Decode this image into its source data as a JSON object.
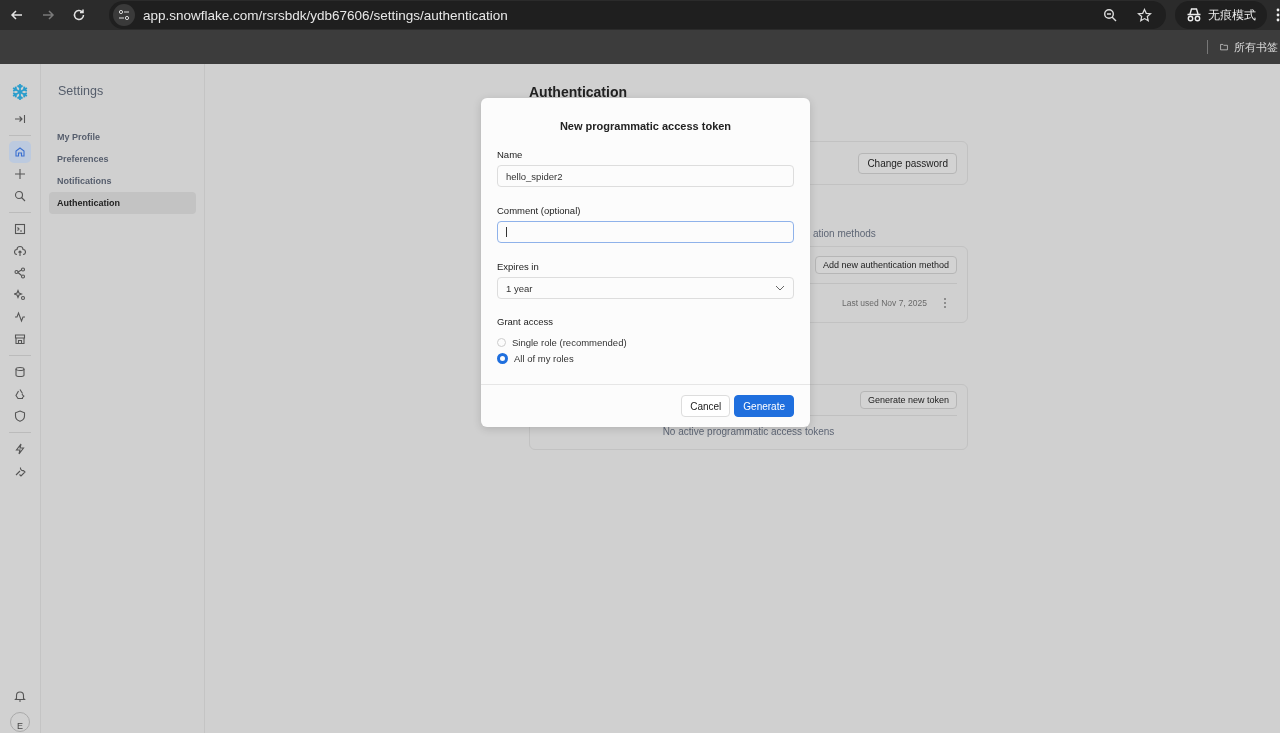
{
  "browser": {
    "url": "app.snowflake.com/rsrsbdk/ydb67606/settings/authentication",
    "incognito_label": "无痕模式",
    "bookmarks_label": "所有书签",
    "forward_disabled": true
  },
  "rail": {
    "groups": [
      [
        {
          "selected": false
        }
      ],
      [
        {
          "selected": true
        },
        {
          "selected": false
        },
        {
          "selected": false
        }
      ],
      [
        {
          "selected": false
        },
        {
          "selected": false
        },
        {
          "selected": false
        },
        {
          "selected": false
        },
        {
          "selected": false
        },
        {
          "selected": false
        }
      ],
      [
        {
          "selected": false
        },
        {
          "selected": false
        },
        {
          "selected": false
        }
      ],
      [
        {
          "selected": false
        },
        {
          "selected": false
        }
      ]
    ],
    "avatar": "E"
  },
  "sidebar": {
    "title": "Settings",
    "items": [
      {
        "label": "My Profile",
        "selected": false
      },
      {
        "label": "Preferences",
        "selected": false
      },
      {
        "label": "Notifications",
        "selected": false
      },
      {
        "label": "Authentication",
        "selected": true
      }
    ]
  },
  "main": {
    "title": "Authentication",
    "password_button": "Change password",
    "methods_heading": "ation methods",
    "add_method_button": "Add new authentication method",
    "last_used": "Last used Nov 7, 2025",
    "generate_token_button": "Generate new token",
    "empty_tokens": "No active programmatic access tokens"
  },
  "dialog": {
    "title": "New programmatic access token",
    "name": {
      "label": "Name",
      "value": "hello_spider2",
      "focused": false
    },
    "comment": {
      "label": "Comment (optional)",
      "focused": true
    },
    "expires": {
      "label": "Expires in",
      "value": "1 year"
    },
    "grant": {
      "label": "Grant access",
      "options": [
        {
          "label": "Single role (recommended)",
          "selected": false
        },
        {
          "label": "All of my roles",
          "selected": true
        }
      ]
    },
    "buttons": [
      {
        "label": "Cancel",
        "kind": "secondary"
      },
      {
        "label": "Generate",
        "kind": "primary"
      }
    ]
  }
}
